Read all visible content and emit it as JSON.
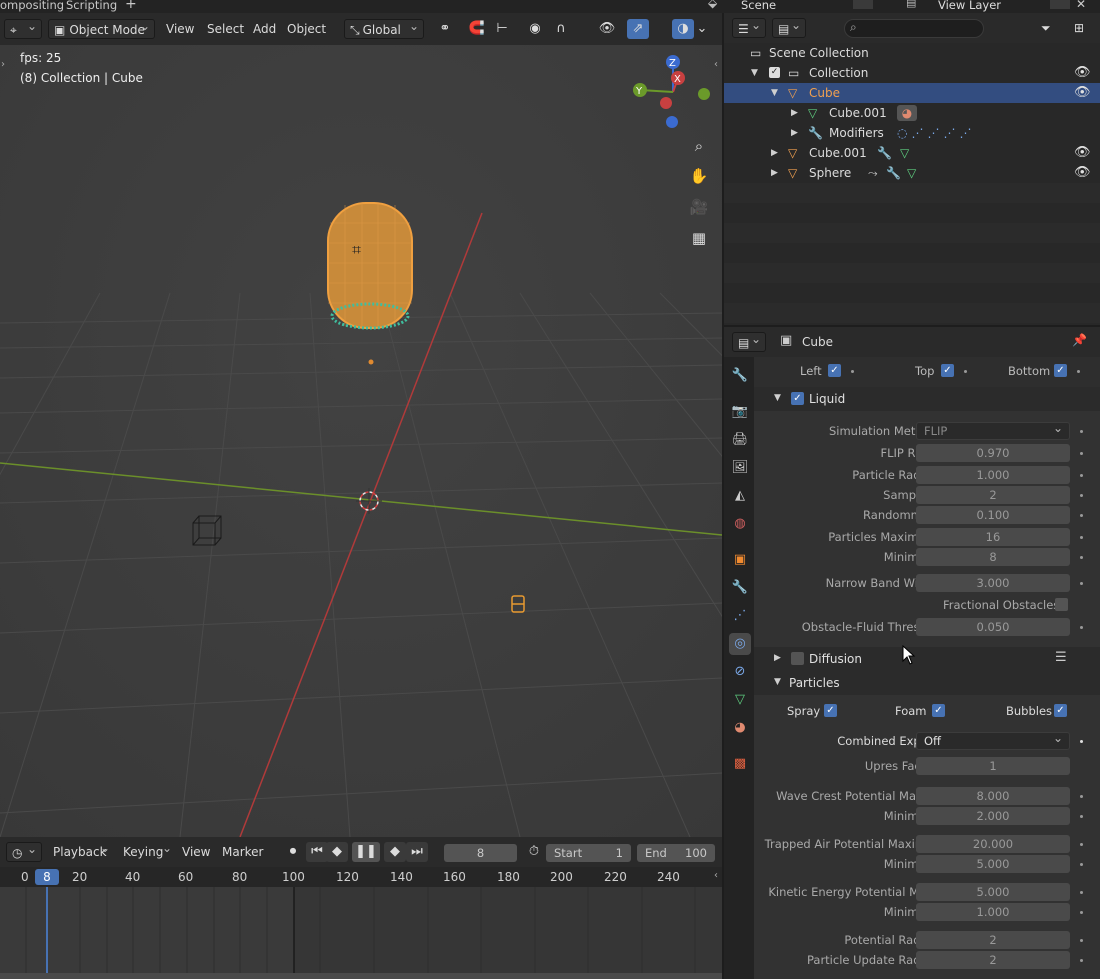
{
  "workspace_tabs": [
    "ompositing",
    "Scripting",
    "+"
  ],
  "top_right": {
    "scene": "Scene",
    "view_layer": "View Layer"
  },
  "viewport": {
    "mode": "Object Mode",
    "menus": [
      "View",
      "Select",
      "Add",
      "Object"
    ],
    "transform": "Global",
    "fps_text": "fps: 25",
    "collection_text": "(8) Collection | Cube",
    "gizmo_axes": {
      "z": "Z",
      "x": "X",
      "y": "Y"
    }
  },
  "timeline": {
    "menus": [
      "Playback",
      "Keying",
      "View",
      "Marker"
    ],
    "current_frame": "8",
    "start_label": "Start",
    "start": "1",
    "end_label": "End",
    "end": "100",
    "ruler_ticks": [
      "0",
      "8",
      "20",
      "40",
      "60",
      "80",
      "100",
      "120",
      "140",
      "160",
      "180",
      "200",
      "220",
      "240"
    ]
  },
  "outliner": {
    "search_placeholder": "",
    "rows": [
      {
        "label": "Scene Collection"
      },
      {
        "label": "Collection"
      },
      {
        "label": "Cube"
      },
      {
        "label": "Cube.001"
      },
      {
        "label": "Modifiers"
      },
      {
        "label": "Cube.001"
      },
      {
        "label": "Sphere"
      }
    ]
  },
  "properties": {
    "object_name": "Cube",
    "sides": {
      "left": "Left",
      "top": "Top",
      "bottom": "Bottom"
    },
    "liquid_panel": "Liquid",
    "fields": {
      "simulation_method": {
        "label": "Simulation Method",
        "value": "FLIP"
      },
      "flip_ratio": {
        "label": "FLIP Ratio",
        "value": "0.970"
      },
      "particle_radius": {
        "label": "Particle Radius",
        "value": "1.000"
      },
      "sampling": {
        "label": "Sampling",
        "value": "2"
      },
      "randomness": {
        "label": "Randomness",
        "value": "0.100"
      },
      "particles_max": {
        "label": "Particles Maximum",
        "value": "16"
      },
      "particles_min": {
        "label": "Minimum",
        "value": "8"
      },
      "narrow_band": {
        "label": "Narrow Band Width",
        "value": "3.000"
      },
      "fractional": {
        "label": "Fractional Obstacles"
      },
      "obstacle_threshold": {
        "label": "Obstacle-Fluid Threshol",
        "value": "0.050"
      }
    },
    "diffusion_panel": "Diffusion",
    "particles_panel": "Particles",
    "particle_types": {
      "spray": "Spray",
      "foam": "Foam",
      "bubbles": "Bubbles"
    },
    "particle_fields": {
      "combined_export": {
        "label": "Combined Export",
        "value": "Off"
      },
      "upres": {
        "label": "Upres Factor",
        "value": "1"
      },
      "wave_crest_max": {
        "label": "Wave Crest Potential Maxi...",
        "value": "8.000"
      },
      "wave_crest_min": {
        "label": "Minimum",
        "value": "2.000"
      },
      "trapped_air_max": {
        "label": "Trapped Air Potential Maxim...",
        "value": "20.000"
      },
      "trapped_air_min": {
        "label": "Minimum",
        "value": "5.000"
      },
      "kinetic_max": {
        "label": "Kinetic Energy Potential Ma...",
        "value": "5.000"
      },
      "kinetic_min": {
        "label": "Minimum",
        "value": "1.000"
      },
      "potential_radius": {
        "label": "Potential Radius",
        "value": "2"
      },
      "update_radius": {
        "label": "Particle Update Radius",
        "value": "2"
      }
    }
  }
}
